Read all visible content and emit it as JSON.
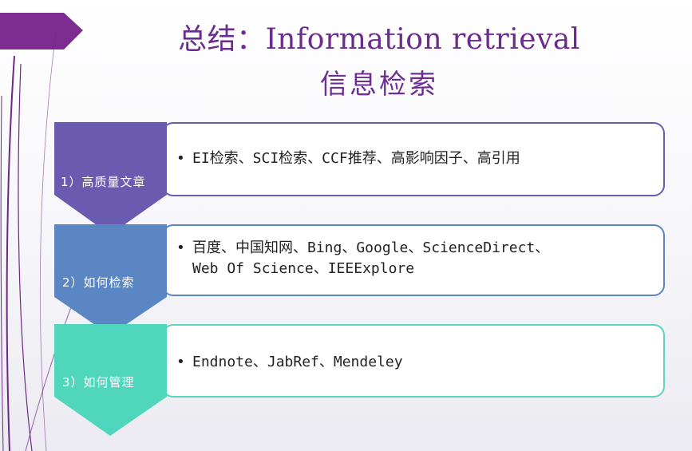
{
  "title": {
    "line1": "总结：Information retrieval",
    "line2": "信息检索"
  },
  "steps": [
    {
      "label": "1）高质量文章",
      "lines": [
        "EI检索、SCI检索、CCF推荐、高影响因子、高引用"
      ],
      "color": "#6a5bb1"
    },
    {
      "label": "2）如何检索",
      "lines": [
        "百度、中国知网、Bing、Google、ScienceDirect、",
        "Web Of Science、IEEExplore"
      ],
      "color": "#5b86c4"
    },
    {
      "label": "3）如何管理",
      "lines": [
        "Endnote、JabRef、Mendeley"
      ],
      "color": "#4fd6bd"
    }
  ],
  "colors": {
    "title": "#6b2c8e",
    "top_left_tab": "#7d2d8f",
    "decor_lines": "#6a2a86"
  }
}
